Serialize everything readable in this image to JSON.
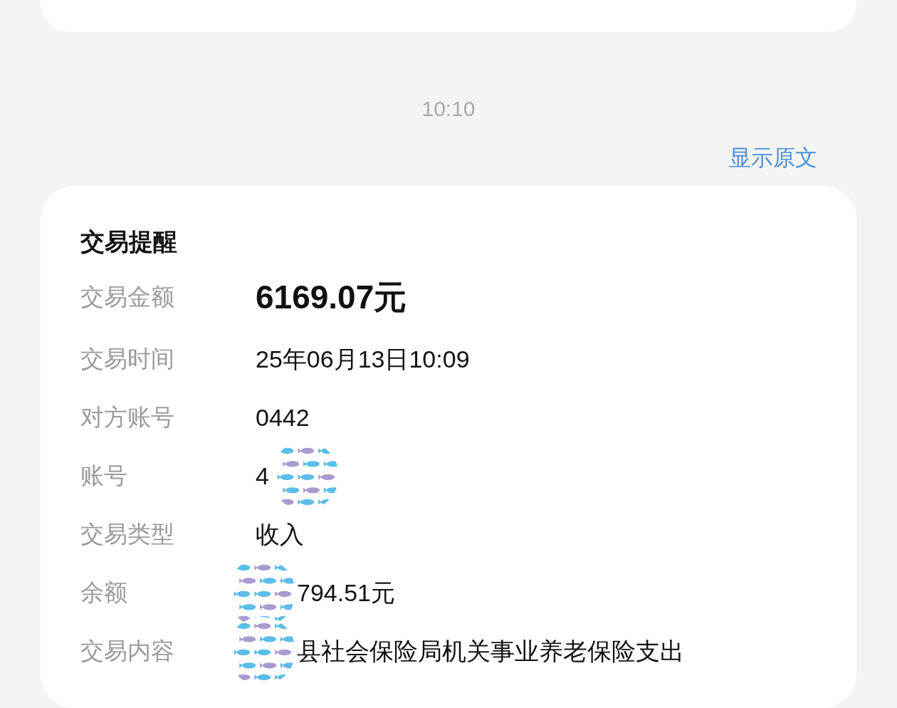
{
  "time": "10:10",
  "show_original_link": "显示原文",
  "card": {
    "title": "交易提醒",
    "rows": [
      {
        "label": "交易金额",
        "value": "6169.07元",
        "kind": "amount"
      },
      {
        "label": "交易时间",
        "value": "25年06月13日10:09",
        "kind": "plain"
      },
      {
        "label": "对方账号",
        "value": "0442",
        "kind": "plain"
      },
      {
        "label": "账号",
        "value": "4",
        "kind": "plain",
        "sticker_after": true
      },
      {
        "label": "交易类型",
        "value": "收入",
        "kind": "plain"
      },
      {
        "label": "余额",
        "value": "794.51元",
        "kind": "plain",
        "sticker_before": true
      },
      {
        "label": "交易内容",
        "value": "县社会保险局机关事业养老保险支出",
        "kind": "plain",
        "sticker_before": true
      }
    ]
  }
}
